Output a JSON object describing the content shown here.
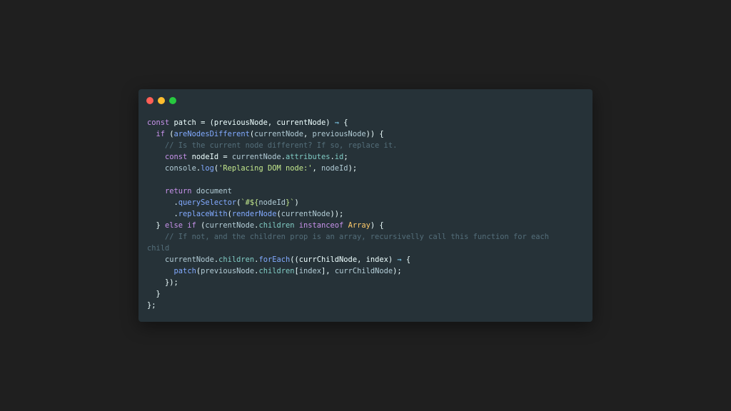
{
  "window": {
    "controls": [
      {
        "name": "close",
        "color": "#ff5f56"
      },
      {
        "name": "minimize",
        "color": "#ffbd2e"
      },
      {
        "name": "zoom",
        "color": "#27c93f"
      }
    ]
  },
  "code_lines": [
    [
      {
        "t": "keyword",
        "v": "const"
      },
      {
        "t": "plain",
        "v": " patch = (previousNode, currentNode) "
      },
      {
        "t": "punct",
        "v": "⇒"
      },
      {
        "t": "plain",
        "v": " {"
      }
    ],
    [
      {
        "t": "plain",
        "v": "  "
      },
      {
        "t": "keyword",
        "v": "if"
      },
      {
        "t": "plain",
        "v": " ("
      },
      {
        "t": "func",
        "v": "areNodesDifferent"
      },
      {
        "t": "plain",
        "v": "("
      },
      {
        "t": "ident",
        "v": "currentNode"
      },
      {
        "t": "plain",
        "v": ", "
      },
      {
        "t": "ident",
        "v": "previousNode"
      },
      {
        "t": "plain",
        "v": ")) {"
      }
    ],
    [
      {
        "t": "plain",
        "v": "    "
      },
      {
        "t": "comment",
        "v": "// Is the current node different? If so, replace it."
      }
    ],
    [
      {
        "t": "plain",
        "v": "    "
      },
      {
        "t": "keyword",
        "v": "const"
      },
      {
        "t": "plain",
        "v": " nodeId = "
      },
      {
        "t": "ident",
        "v": "currentNode"
      },
      {
        "t": "plain",
        "v": "."
      },
      {
        "t": "prop",
        "v": "attributes"
      },
      {
        "t": "plain",
        "v": "."
      },
      {
        "t": "prop",
        "v": "id"
      },
      {
        "t": "plain",
        "v": ";"
      }
    ],
    [
      {
        "t": "plain",
        "v": "    "
      },
      {
        "t": "ident",
        "v": "console"
      },
      {
        "t": "plain",
        "v": "."
      },
      {
        "t": "func",
        "v": "log"
      },
      {
        "t": "plain",
        "v": "("
      },
      {
        "t": "string",
        "v": "'Replacing DOM node:'"
      },
      {
        "t": "plain",
        "v": ", "
      },
      {
        "t": "ident",
        "v": "nodeId"
      },
      {
        "t": "plain",
        "v": ");"
      }
    ],
    [
      {
        "t": "plain",
        "v": " "
      }
    ],
    [
      {
        "t": "plain",
        "v": "    "
      },
      {
        "t": "keyword",
        "v": "return"
      },
      {
        "t": "plain",
        "v": " "
      },
      {
        "t": "ident",
        "v": "document"
      }
    ],
    [
      {
        "t": "plain",
        "v": "      ."
      },
      {
        "t": "func",
        "v": "querySelector"
      },
      {
        "t": "plain",
        "v": "("
      },
      {
        "t": "string",
        "v": "`#${"
      },
      {
        "t": "ident",
        "v": "nodeId"
      },
      {
        "t": "string",
        "v": "}`"
      },
      {
        "t": "plain",
        "v": ")"
      }
    ],
    [
      {
        "t": "plain",
        "v": "      ."
      },
      {
        "t": "func",
        "v": "replaceWith"
      },
      {
        "t": "plain",
        "v": "("
      },
      {
        "t": "func",
        "v": "renderNode"
      },
      {
        "t": "plain",
        "v": "("
      },
      {
        "t": "ident",
        "v": "currentNode"
      },
      {
        "t": "plain",
        "v": "));"
      }
    ],
    [
      {
        "t": "plain",
        "v": "  } "
      },
      {
        "t": "keyword",
        "v": "else if"
      },
      {
        "t": "plain",
        "v": " ("
      },
      {
        "t": "ident",
        "v": "currentNode"
      },
      {
        "t": "plain",
        "v": "."
      },
      {
        "t": "prop",
        "v": "children"
      },
      {
        "t": "plain",
        "v": " "
      },
      {
        "t": "keyword",
        "v": "instanceof"
      },
      {
        "t": "plain",
        "v": " "
      },
      {
        "t": "type",
        "v": "Array"
      },
      {
        "t": "plain",
        "v": ") {"
      }
    ],
    [
      {
        "t": "plain",
        "v": "    "
      },
      {
        "t": "comment",
        "v": "// If not, and the children prop is an array, recursivelly call this function for each"
      }
    ],
    [
      {
        "t": "comment",
        "v": "child"
      }
    ],
    [
      {
        "t": "plain",
        "v": "    "
      },
      {
        "t": "ident",
        "v": "currentNode"
      },
      {
        "t": "plain",
        "v": "."
      },
      {
        "t": "prop",
        "v": "children"
      },
      {
        "t": "plain",
        "v": "."
      },
      {
        "t": "func",
        "v": "forEach"
      },
      {
        "t": "plain",
        "v": "((currChildNode, index) "
      },
      {
        "t": "punct",
        "v": "⇒"
      },
      {
        "t": "plain",
        "v": " {"
      }
    ],
    [
      {
        "t": "plain",
        "v": "      "
      },
      {
        "t": "func",
        "v": "patch"
      },
      {
        "t": "plain",
        "v": "("
      },
      {
        "t": "ident",
        "v": "previousNode"
      },
      {
        "t": "plain",
        "v": "."
      },
      {
        "t": "prop",
        "v": "children"
      },
      {
        "t": "plain",
        "v": "["
      },
      {
        "t": "ident",
        "v": "index"
      },
      {
        "t": "plain",
        "v": "], "
      },
      {
        "t": "ident",
        "v": "currChildNode"
      },
      {
        "t": "plain",
        "v": ");"
      }
    ],
    [
      {
        "t": "plain",
        "v": "    });"
      }
    ],
    [
      {
        "t": "plain",
        "v": "  }"
      }
    ],
    [
      {
        "t": "plain",
        "v": "};"
      }
    ]
  ]
}
